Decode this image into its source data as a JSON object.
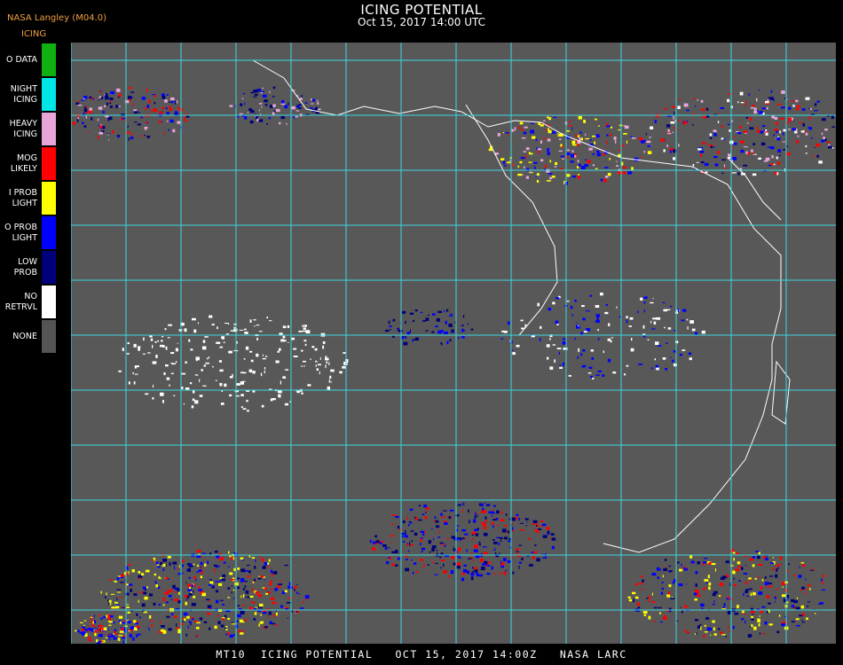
{
  "header": {
    "title": "ICING POTENTIAL",
    "subtitle": "Oct 15, 2017 14:00 UTC",
    "org": "NASA Langley (M04.0)",
    "legend_title": "ICING"
  },
  "legend": [
    {
      "lines": [
        "O DATA"
      ],
      "color": "#10b010"
    },
    {
      "lines": [
        "NIGHT",
        "ICING"
      ],
      "color": "#00e6e6"
    },
    {
      "lines": [
        "HEAVY",
        "ICING"
      ],
      "color": "#e8a6d8"
    },
    {
      "lines": [
        "MOG",
        "LIKELY"
      ],
      "color": "#ff0000"
    },
    {
      "lines": [
        "I PROB",
        "LIGHT"
      ],
      "color": "#ffff00"
    },
    {
      "lines": [
        "O PROB",
        "LIGHT"
      ],
      "color": "#0000ff"
    },
    {
      "lines": [
        "LOW",
        "PROB"
      ],
      "color": "#00007a"
    },
    {
      "lines": [
        "NO",
        "RETRVL"
      ],
      "color": "#ffffff"
    },
    {
      "lines": [
        "NONE"
      ],
      "color": "#555555"
    }
  ],
  "map": {
    "background": "#585858",
    "grid_color": "#3ad8e0"
  },
  "footer": "MT10  ICING POTENTIAL   OCT 15, 2017 14:00Z   NASA LARC"
}
